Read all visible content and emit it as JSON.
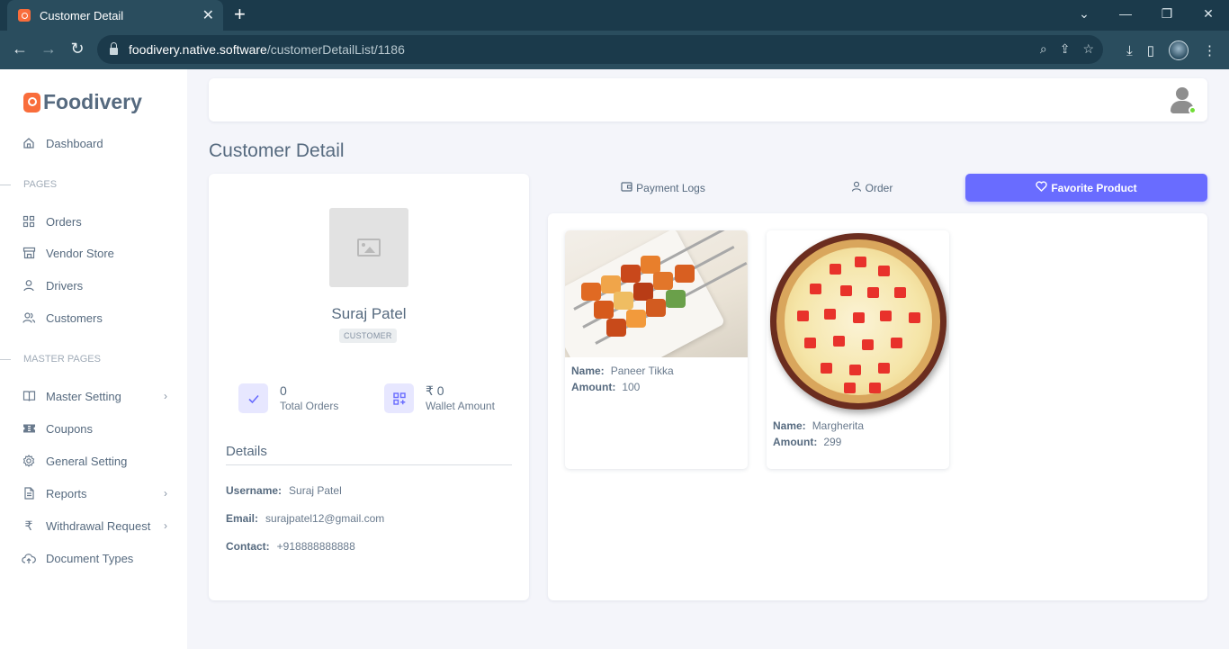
{
  "browser": {
    "tab_title": "Customer Detail",
    "url_domain": "foodivery.native.software",
    "url_path": "/customerDetailList/1186"
  },
  "sidebar": {
    "brand": "Foodivery",
    "items": [
      {
        "label": "Dashboard",
        "icon": "home-icon"
      },
      {
        "label": "Orders",
        "icon": "grid-icon"
      },
      {
        "label": "Vendor Store",
        "icon": "store-icon"
      },
      {
        "label": "Drivers",
        "icon": "user-icon"
      },
      {
        "label": "Customers",
        "icon": "users-icon"
      },
      {
        "label": "Master Setting",
        "icon": "book-icon"
      },
      {
        "label": "Coupons",
        "icon": "ticket-icon"
      },
      {
        "label": "General Setting",
        "icon": "gear-icon"
      },
      {
        "label": "Reports",
        "icon": "file-icon"
      },
      {
        "label": "Withdrawal Request",
        "icon": "rupee-icon"
      },
      {
        "label": "Document Types",
        "icon": "cloud-upload-icon"
      }
    ],
    "section_pages": "PAGES",
    "section_master": "MASTER PAGES"
  },
  "page": {
    "title": "Customer Detail"
  },
  "customer": {
    "name": "Suraj Patel",
    "role": "CUSTOMER",
    "total_orders_value": "0",
    "total_orders_label": "Total Orders",
    "wallet_value": "₹ 0",
    "wallet_label": "Wallet Amount",
    "details_heading": "Details",
    "username_label": "Username:",
    "username": "Suraj Patel",
    "email_label": "Email:",
    "email": "surajpatel12@gmail.com",
    "contact_label": "Contact:",
    "contact": "+918888888888"
  },
  "tabs": {
    "payment_logs": "Payment Logs",
    "order": "Order",
    "favorite_product": "Favorite Product"
  },
  "products": [
    {
      "name_label": "Name:",
      "name": "Paneer Tikka",
      "amount_label": "Amount:",
      "amount": "100"
    },
    {
      "name_label": "Name:",
      "name": "Margherita",
      "amount_label": "Amount:",
      "amount": "299"
    }
  ],
  "colors": {
    "accent": "#696cff",
    "brand": "#f96d3b",
    "online": "#71dd37"
  }
}
